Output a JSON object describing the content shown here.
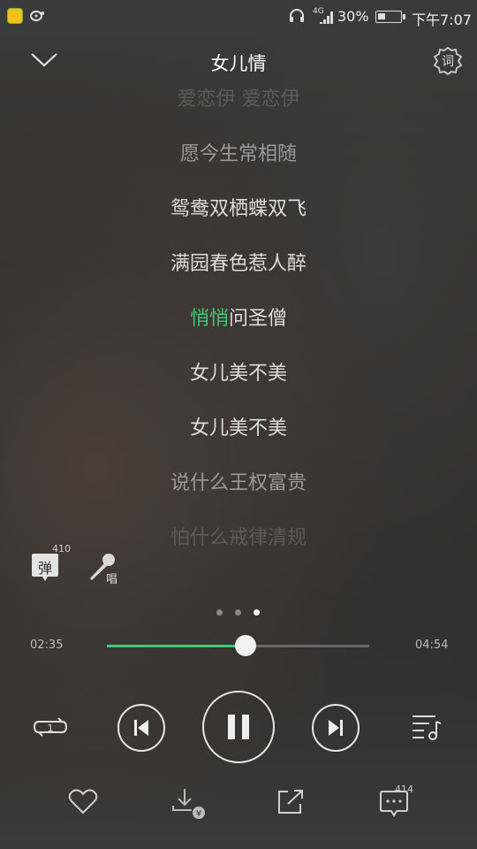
{
  "status_bar": {
    "network": "4G",
    "battery": "30%",
    "time": "下午7:07"
  },
  "header": {
    "title": "女儿情",
    "settings_label": "词"
  },
  "lyrics": [
    {
      "text": "爱恋伊 爱恋伊",
      "state": "faded"
    },
    {
      "text": "愿今生常相随",
      "state": "dim"
    },
    {
      "text": "鸳鸯双栖蝶双飞",
      "state": "normal"
    },
    {
      "text": "满园春色惹人醉",
      "state": "normal"
    },
    {
      "text": "悄悄问圣僧",
      "state": "current",
      "sung": "悄悄",
      "unsung": "问圣僧"
    },
    {
      "text": "女儿美不美",
      "state": "normal"
    },
    {
      "text": "女儿美不美",
      "state": "normal"
    },
    {
      "text": "说什么王权富贵",
      "state": "dim"
    },
    {
      "text": "怕什么戒律清规",
      "state": "faded"
    }
  ],
  "danmu": {
    "label": "弹",
    "count": "410"
  },
  "karaoke": {
    "label": "唱"
  },
  "pager": {
    "count": 3,
    "active": 2
  },
  "progress": {
    "current": "02:35",
    "total": "04:54",
    "fraction": 0.53
  },
  "comments": {
    "count": "414"
  },
  "colors": {
    "accent": "#3ec978",
    "text": "#ffffff"
  }
}
